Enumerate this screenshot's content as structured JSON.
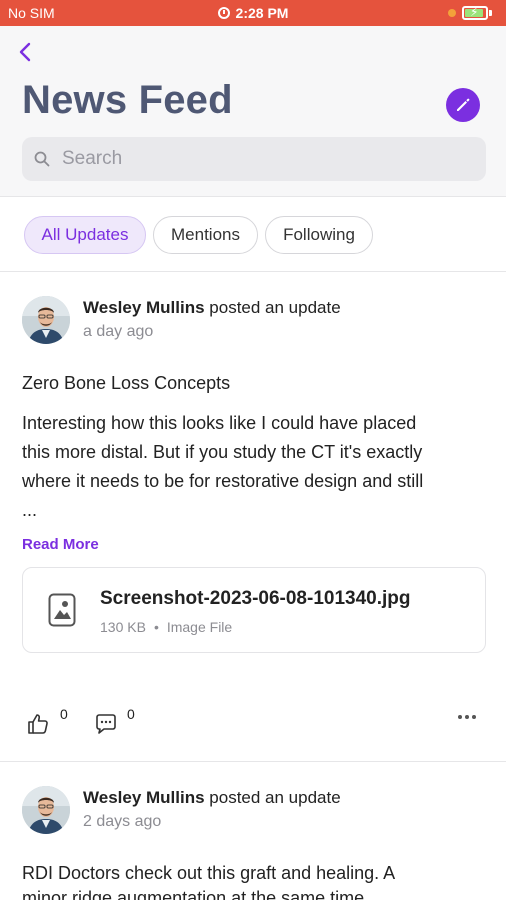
{
  "status_bar": {
    "carrier": "No SIM",
    "time": "2:28 PM",
    "battery_level": 0.9
  },
  "header": {
    "back_icon": "chevron-left-icon",
    "title": "News Feed",
    "compose_icon": "pencil-icon",
    "search_placeholder": "Search"
  },
  "filters": [
    {
      "label": "All Updates",
      "active": true
    },
    {
      "label": "Mentions",
      "active": false
    },
    {
      "label": "Following",
      "active": false
    }
  ],
  "posts": [
    {
      "author": "Wesley Mullins",
      "action": " posted an update",
      "time": "a day ago",
      "title": "Zero Bone Loss Concepts",
      "body_lines": [
        "Interesting how this looks like I could have placed",
        "this more distal.  But if you study the CT it's exactly",
        "where it needs to be for restorative design and still",
        "..."
      ],
      "read_more": "Read More",
      "attachment": {
        "name": "Screenshot-2023-06-08-101340.jpg",
        "size": "130 KB",
        "separator": "•",
        "type": "Image File"
      },
      "likes": "0",
      "comments": "0"
    },
    {
      "author": "Wesley Mullins",
      "action": " posted an update",
      "time": "2 days ago",
      "title": "RDI Doctors check out this graft and healing.  A",
      "body_lines": [
        "minor ridge augmentation at the same time"
      ]
    }
  ],
  "colors": {
    "accent": "#7b2fe0",
    "status_bar": "#e5533d",
    "title": "#4f5874"
  }
}
